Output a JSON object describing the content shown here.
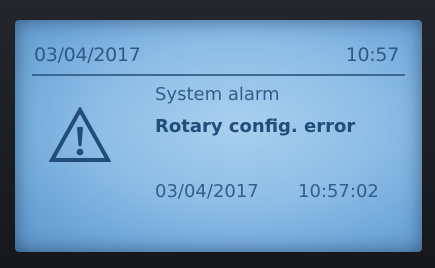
{
  "header": {
    "date": "03/04/2017",
    "time": "10:57"
  },
  "alarm": {
    "title": "System alarm",
    "message": "Rotary config. error",
    "date": "03/04/2017",
    "time": "10:57:02",
    "icon": "warning-icon"
  },
  "colors": {
    "screen": "#8cbde6",
    "text": "#325e8b",
    "text_strong": "#214d79",
    "divider": "#3b6793"
  }
}
